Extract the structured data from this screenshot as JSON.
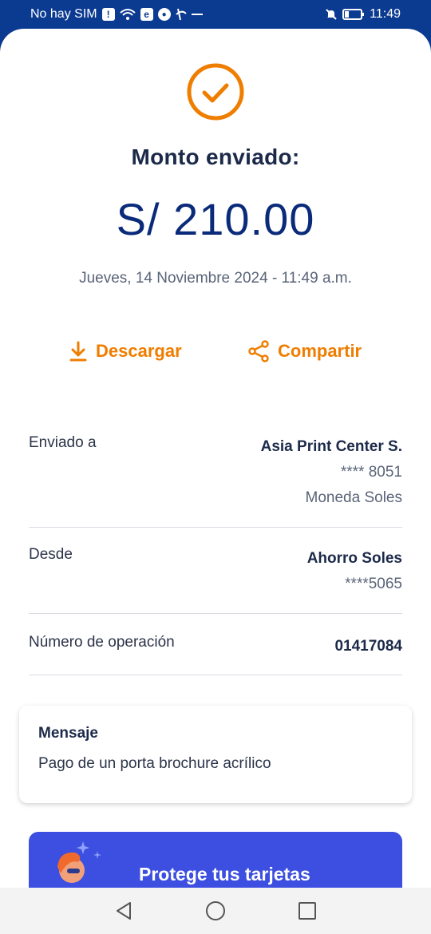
{
  "status_bar": {
    "carrier": "No hay SIM",
    "time": "11:49"
  },
  "receipt": {
    "title": "Monto enviado:",
    "amount": "S/ 210.00",
    "date": "Jueves, 14 Noviembre 2024 - 11:49 a.m."
  },
  "actions": {
    "download_label": "Descargar",
    "share_label": "Compartir"
  },
  "details": {
    "sent_to": {
      "label": "Enviado a",
      "name": "Asia Print Center S.",
      "account": "**** 8051",
      "currency": "Moneda Soles"
    },
    "from": {
      "label": "Desde",
      "account_name": "Ahorro Soles",
      "account": "****5065"
    },
    "operation": {
      "label": "Número de operación",
      "number": "01417084"
    }
  },
  "message": {
    "title": "Mensaje",
    "text": "Pago de un porta brochure acrílico"
  },
  "promo": {
    "text": "Protege tus tarjetas"
  },
  "colors": {
    "brand_blue": "#0b3a91",
    "accent_orange": "#ef7d00",
    "amount_blue": "#0a2a7a",
    "promo_blue": "#3d4fe0"
  }
}
